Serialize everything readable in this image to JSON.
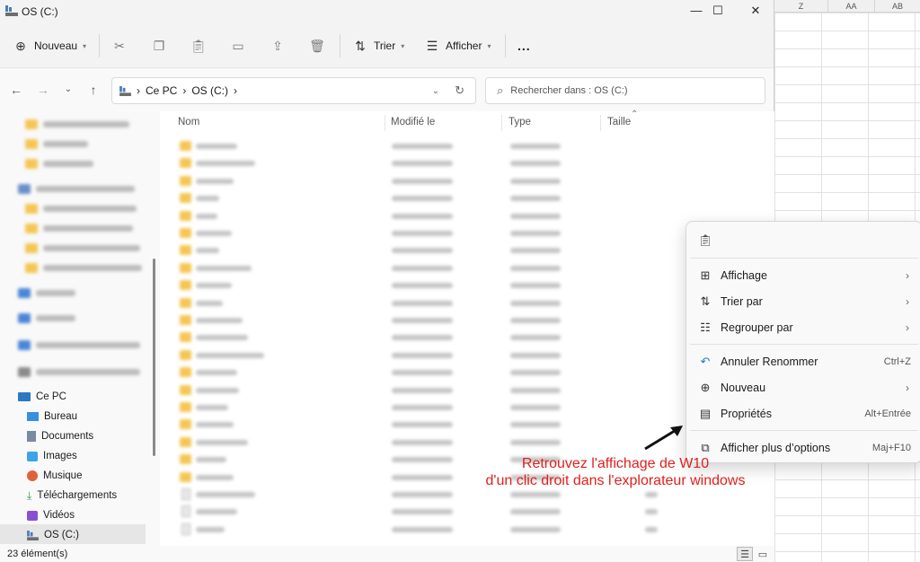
{
  "window": {
    "title": "OS (C:)"
  },
  "window_controls": {
    "minimize": "—",
    "maximize": "☐",
    "close": "✕"
  },
  "excel": {
    "columns": [
      "Z",
      "AA",
      "AB"
    ]
  },
  "toolbar": {
    "new_label": "Nouveau",
    "sort_label": "Trier",
    "view_label": "Afficher",
    "more_label": "..."
  },
  "navigation": {
    "breadcrumb": [
      "Ce PC",
      "OS (C:)"
    ],
    "search_placeholder": "Rechercher dans : OS (C:)"
  },
  "sidebar": {
    "this_pc": "Ce PC",
    "items": [
      "Bureau",
      "Documents",
      "Images",
      "Musique",
      "Téléchargements",
      "Vidéos",
      "OS (C:)"
    ]
  },
  "columns": {
    "name": "Nom",
    "modified": "Modifié le",
    "type": "Type",
    "size": "Taille"
  },
  "status": {
    "item_count": "23 élément(s)"
  },
  "context_menu": {
    "items": [
      {
        "label": "Affichage",
        "icon": "grid-icon",
        "submenu": true
      },
      {
        "label": "Trier par",
        "icon": "sort-icon",
        "submenu": true
      },
      {
        "label": "Regrouper par",
        "icon": "group-icon",
        "submenu": true
      },
      {
        "label": "Annuler Renommer",
        "icon": "undo-icon",
        "shortcut": "Ctrl+Z"
      },
      {
        "label": "Nouveau",
        "icon": "plus-icon",
        "submenu": true
      },
      {
        "label": "Propriétés",
        "icon": "properties-icon",
        "shortcut": "Alt+Entrée"
      },
      {
        "label": "Afficher plus d’options",
        "icon": "more-options-icon",
        "shortcut": "Maj+F10"
      }
    ]
  },
  "annotation": {
    "line1": "Retrouvez l'affichage de W10",
    "line2": "d'un clic droit dans l'explorateur windows",
    "color": "#e0201c"
  }
}
